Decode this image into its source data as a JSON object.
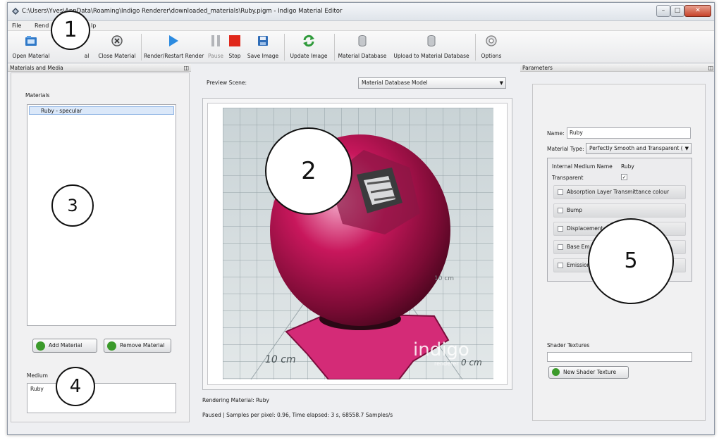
{
  "window": {
    "title": "C:\\Users\\Yves\\AppData\\Roaming\\Indigo Renderer\\downloaded_materials\\Ruby.pigm - Indigo Material Editor",
    "min_glyph": "–",
    "max_glyph": "□",
    "close_glyph": "✕"
  },
  "menu": {
    "file": "File",
    "render": "Rend",
    "help": "lp"
  },
  "toolbar": {
    "open_material": "Open Material",
    "save_material": "al",
    "close_material": "Close Material",
    "render_restart": "Render/Restart Render",
    "pause": "Pause",
    "stop": "Stop",
    "save_image": "Save Image",
    "update_image": "Update Image",
    "material_database": "Material Database",
    "upload": "Upload to Material Database",
    "options": "Options"
  },
  "left_panel": {
    "header": "Materials and Media",
    "materials_label": "Materials",
    "materials": [
      "Ruby - specular"
    ],
    "add_button": "Add Material",
    "remove_button": "Remove Material",
    "medium_label": "Medium",
    "media": [
      "Ruby"
    ]
  },
  "center": {
    "preview_scene_label": "Preview Scene:",
    "preview_scene_value": "Material Database Model",
    "floor_label_left": "10 cm",
    "floor_label_right": "0 cm",
    "floor_label_small": "10 cm",
    "watermark": "indigo",
    "watermark_sub": "renderer",
    "rendering_status": "Rendering Material: Ruby",
    "progress_status": "Paused | Samples per pixel: 0.96, Time elapsed: 3 s, 68558.7 Samples/s"
  },
  "right_panel": {
    "header": "Parameters",
    "name_label": "Name:",
    "name_value": "Ruby",
    "material_type_label": "Material Type:",
    "material_type_value": "Perfectly Smooth and Transparent (",
    "internal_medium_label": "Internal Medium Name",
    "internal_medium_value": "Ruby",
    "transparent_label": "Transparent",
    "transparent_check": "✓",
    "rows": [
      "Absorption Layer Transmittance colour",
      "Bump",
      "Displacement",
      "Base Em",
      "Emission"
    ],
    "shader_textures_label": "Shader Textures",
    "new_shader_texture": "New Shader Texture"
  },
  "callouts": [
    "1",
    "2",
    "3",
    "4",
    "5"
  ]
}
